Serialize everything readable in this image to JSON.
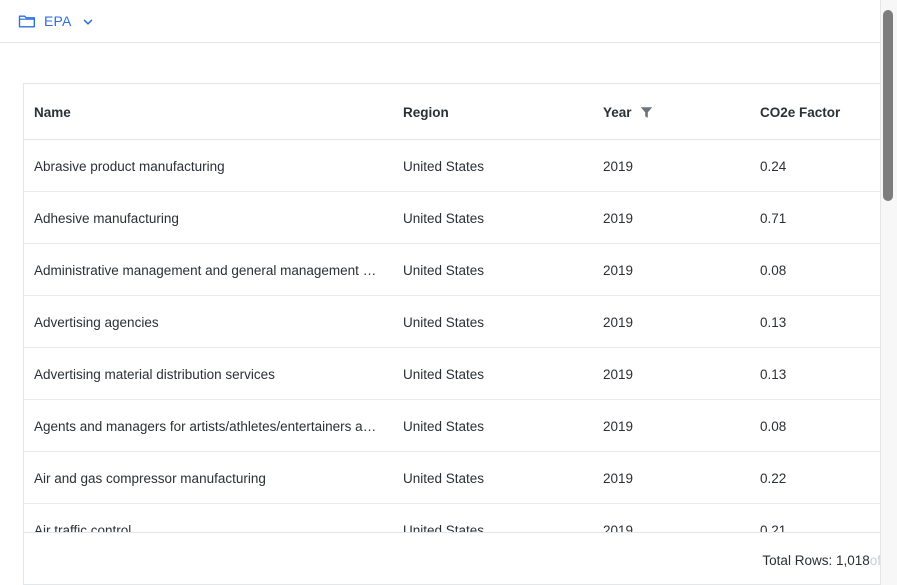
{
  "breadcrumb": {
    "label": "EPA",
    "folder_icon": "folder-icon",
    "chevron_icon": "chevron-down-icon",
    "accent_color": "#2f6fde"
  },
  "table": {
    "columns": [
      "Name",
      "Region",
      "Year",
      "CO2e Factor"
    ],
    "year_filter_icon": "filter-icon",
    "rows": [
      {
        "name": "Abrasive product manufacturing",
        "region": "United States",
        "year": "2019",
        "factor": "0.24"
      },
      {
        "name": "Adhesive manufacturing",
        "region": "United States",
        "year": "2019",
        "factor": "0.71"
      },
      {
        "name": "Administrative management and general management consulting services",
        "region": "United States",
        "year": "2019",
        "factor": "0.08"
      },
      {
        "name": "Advertising agencies",
        "region": "United States",
        "year": "2019",
        "factor": "0.13"
      },
      {
        "name": "Advertising material distribution services",
        "region": "United States",
        "year": "2019",
        "factor": "0.13"
      },
      {
        "name": "Agents and managers for artists/athletes/entertainers and other public figures",
        "region": "United States",
        "year": "2019",
        "factor": "0.08"
      },
      {
        "name": "Air and gas compressor manufacturing",
        "region": "United States",
        "year": "2019",
        "factor": "0.22"
      },
      {
        "name": "Air traffic control",
        "region": "United States",
        "year": "2019",
        "factor": "0.21"
      }
    ]
  },
  "footer": {
    "total_label": "Total Rows: 1,018",
    "total_suffix": " of"
  }
}
